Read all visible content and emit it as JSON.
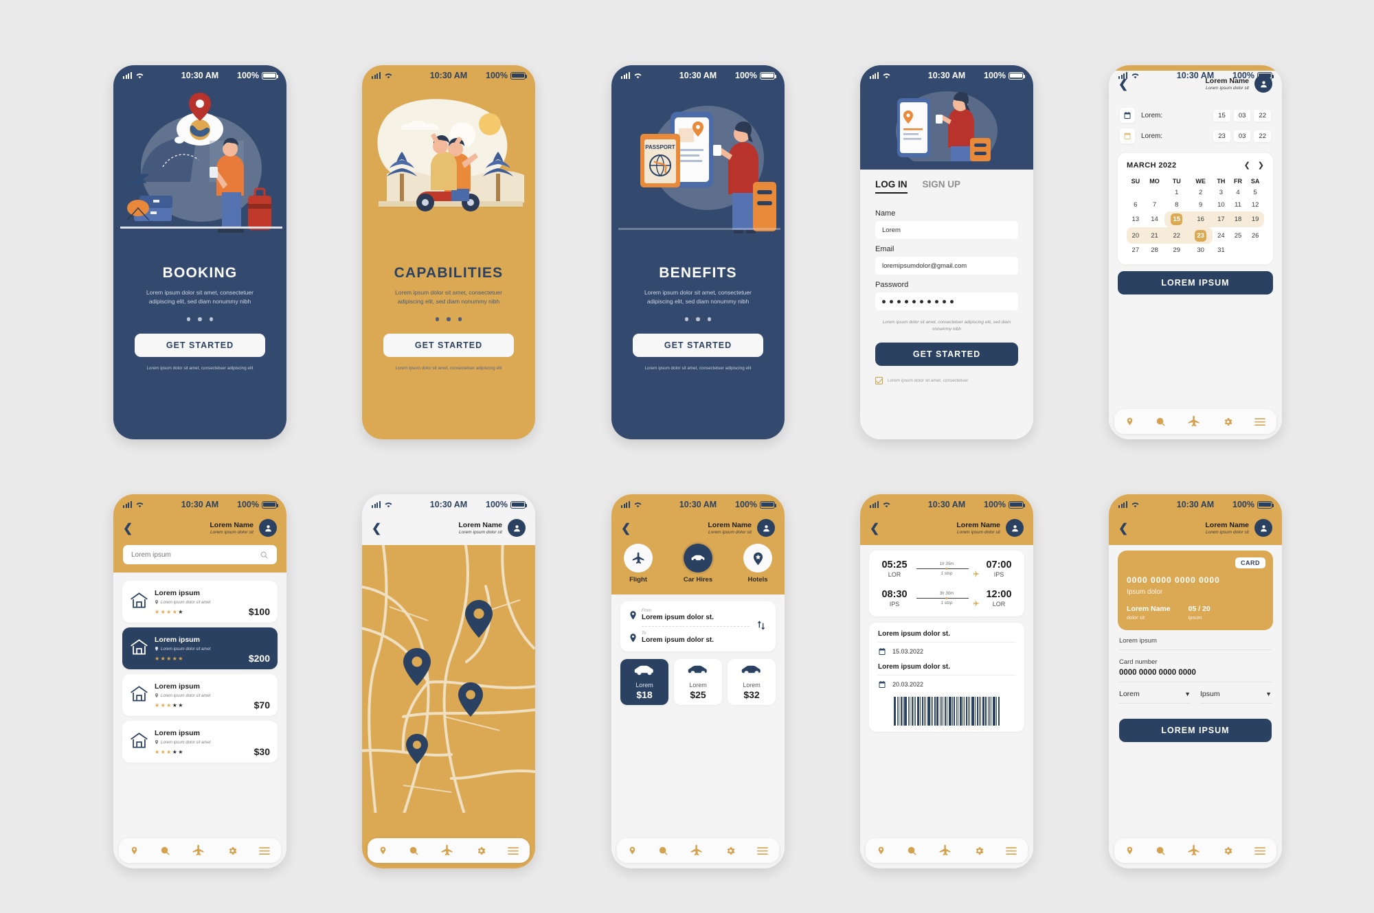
{
  "status_bar": {
    "time": "10:30 AM",
    "battery": "100%"
  },
  "onboarding": [
    {
      "id": "booking",
      "title": "BOOKING",
      "subtitle": "Lorem ipsum dolor sit amet, consectetuer adipiscing elit, sed diam nonummy nibh",
      "cta": "GET STARTED",
      "footer": "Lorem ipsum dolor sit amet, consectetuer adipiscing elit"
    },
    {
      "id": "capabilities",
      "title": "CAPABILITIES",
      "subtitle": "Lorem ipsum dolor sit amet, consectetuer adipiscing elit, sed diam nonummy nibh",
      "cta": "GET STARTED",
      "footer": "Lorem ipsum dolor sit amet, consectetuer adipiscing elit"
    },
    {
      "id": "benefits",
      "title": "BENEFITS",
      "subtitle": "Lorem ipsum dolor sit amet, consectetuer adipiscing elit, sed diam nonummy nibh",
      "cta": "GET STARTED",
      "footer": "Lorem ipsum dolor sit amet, consectetuer adipiscing elit"
    }
  ],
  "login": {
    "tab_login": "LOG IN",
    "tab_signup": "SIGN UP",
    "name_label": "Name",
    "name_value": "Lorem",
    "email_label": "Email",
    "email_value": "loremipsumdolor@gmail.com",
    "password_label": "Password",
    "password_dots": 10,
    "legal": "Lorem ipsum dolor sit amet, consectetuer adipiscing elit, sed diam nonummy nibh",
    "cta": "GET STARTED",
    "consent": "Lorem ipsum dolor sit amet, consectetuer"
  },
  "header": {
    "name": "Lorem Name",
    "subtitle": "Lorem ipsum dolor sit"
  },
  "calendar_screen": {
    "rows": [
      {
        "label": "Lorem:",
        "d": "15",
        "m": "03",
        "y": "22"
      },
      {
        "label": "Lorem:",
        "d": "23",
        "m": "03",
        "y": "22"
      }
    ],
    "month": "MARCH 2022",
    "weekdays": [
      "SU",
      "MO",
      "TU",
      "WE",
      "TH",
      "FR",
      "SA"
    ],
    "weeks": [
      [
        "",
        "",
        "1",
        "2",
        "3",
        "4",
        "5"
      ],
      [
        "6",
        "7",
        "8",
        "9",
        "10",
        "11",
        "12"
      ],
      [
        "13",
        "14",
        "15",
        "16",
        "17",
        "18",
        "19"
      ],
      [
        "20",
        "21",
        "22",
        "23",
        "24",
        "25",
        "26"
      ],
      [
        "27",
        "28",
        "29",
        "30",
        "31",
        "",
        ""
      ]
    ],
    "start_day": "15",
    "end_day": "23",
    "cta": "LOREM IPSUM"
  },
  "search": {
    "placeholder": "Lorem ipsum"
  },
  "hotels": [
    {
      "title": "Lorem ipsum",
      "location": "Lorem ipsum dolor sit amet",
      "stars": 4,
      "price": "$100",
      "selected": false
    },
    {
      "title": "Lorem ipsum",
      "location": "Lorem ipsum dolor sit amet",
      "stars": 5,
      "price": "$200",
      "selected": true
    },
    {
      "title": "Lorem ipsum",
      "location": "Lorem ipsum dolor sit amet",
      "stars": 3,
      "price": "$70",
      "selected": false
    },
    {
      "title": "Lorem ipsum",
      "location": "Lorem ipsum dolor sit amet",
      "stars": 3,
      "price": "$30",
      "selected": false
    }
  ],
  "car_hires": {
    "modes": [
      {
        "label": "Flight",
        "icon": "plane-icon",
        "active": false
      },
      {
        "label": "Car Hires",
        "icon": "car-icon",
        "active": true
      },
      {
        "label": "Hotels",
        "icon": "pin-star-icon",
        "active": false
      }
    ],
    "from_label": "From",
    "from_value": "Lorem ipsum dolor st.",
    "to_label": "To",
    "to_value": "Lorem ipsum dolor st.",
    "cars": [
      {
        "label": "Lorem",
        "price": "$18",
        "selected": true
      },
      {
        "label": "Lorem",
        "price": "$25",
        "selected": false
      },
      {
        "label": "Lorem",
        "price": "$32",
        "selected": false
      }
    ]
  },
  "ticket": {
    "legs": [
      {
        "dep_time": "05:25",
        "dep_code": "LOR",
        "duration": "1h 35m",
        "stops": "1 stop",
        "arr_time": "07:00",
        "arr_code": "IPS"
      },
      {
        "dep_time": "08:30",
        "dep_code": "IPS",
        "duration": "3h 30m",
        "stops": "1 stop",
        "arr_time": "12:00",
        "arr_code": "LOR"
      }
    ],
    "info": [
      {
        "label": "Lorem ipsum dolor st.",
        "date": "15.03.2022"
      },
      {
        "label": "Lorem ipsum dolor st.",
        "date": "20.03.2022"
      }
    ]
  },
  "payment": {
    "card_tag": "CARD",
    "card_number_display": "0000 0000 0000 0000",
    "card_brand": "Ipsum dolor",
    "card_holder": "Lorem Name",
    "card_holder_sub": "dolor sit",
    "card_expiry": "05 / 20",
    "card_expiry_sub": "ipsum",
    "field_name_label": "Lorem ipsum",
    "field_card_label": "Card number",
    "field_card_value": "0000 0000 0000 0000",
    "select_left": "Lorem",
    "select_right": "Ipsum",
    "cta": "LOREM IPSUM"
  },
  "bottom_nav": [
    {
      "icon": "location-pin-icon",
      "name": "nav-location"
    },
    {
      "icon": "search-icon",
      "name": "nav-search"
    },
    {
      "icon": "plane-icon",
      "name": "nav-flights"
    },
    {
      "icon": "gear-icon",
      "name": "nav-settings"
    },
    {
      "icon": "menu-icon",
      "name": "nav-menu"
    }
  ],
  "colors": {
    "navy": "#2b4161",
    "navy_dark": "#33496d",
    "gold": "#dba854",
    "bg": "#eaeaea",
    "card": "#ffffff"
  }
}
